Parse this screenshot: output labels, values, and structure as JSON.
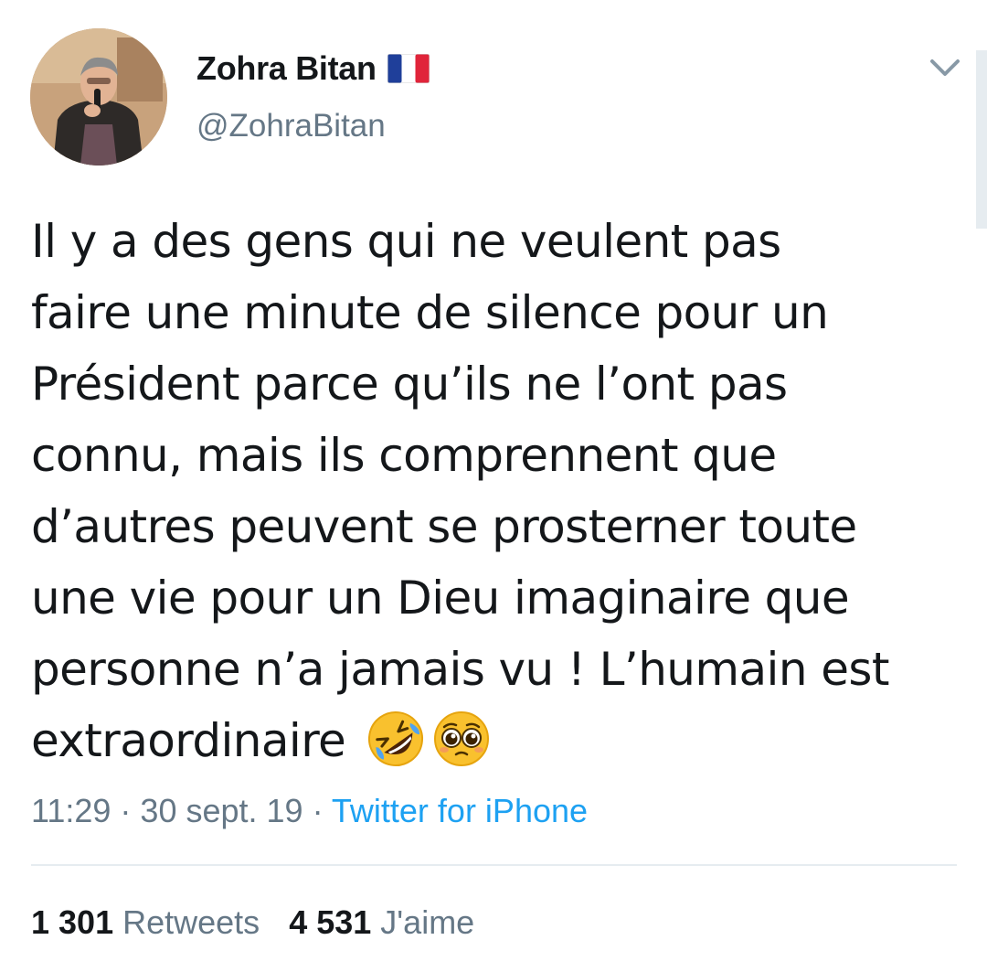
{
  "user": {
    "display_name": "Zohra Bitan",
    "handle": "@ZohraBitan",
    "flag_icon": "france-flag-icon"
  },
  "tweet": {
    "line1": "Il y a des gens qui ne veulent pas",
    "line2": "faire une minute de silence pour un",
    "line3": "Président parce qu’ils ne l’ont pas",
    "line4": "connu, mais ils comprennent que",
    "line5": "d’autres peuvent se prosterner toute",
    "line6": "une vie pour un Dieu imaginaire que",
    "line7": "personne n’a jamais vu ! L’humain est",
    "line8": "extraordinaire",
    "emojis": [
      "rolling-on-floor-laughing-emoji",
      "pleading-face-emoji"
    ]
  },
  "meta": {
    "time": "11:29",
    "sep1": " · ",
    "date": "30 sept. 19",
    "sep2": " · ",
    "source": "Twitter for iPhone"
  },
  "stats": {
    "retweets_count": "1 301",
    "retweets_label": "Retweets",
    "likes_count": "4 531",
    "likes_label": "J'aime"
  },
  "colors": {
    "text": "#14171a",
    "secondary": "#657786",
    "link": "#1da1f2",
    "divider": "#e6ecf0"
  }
}
